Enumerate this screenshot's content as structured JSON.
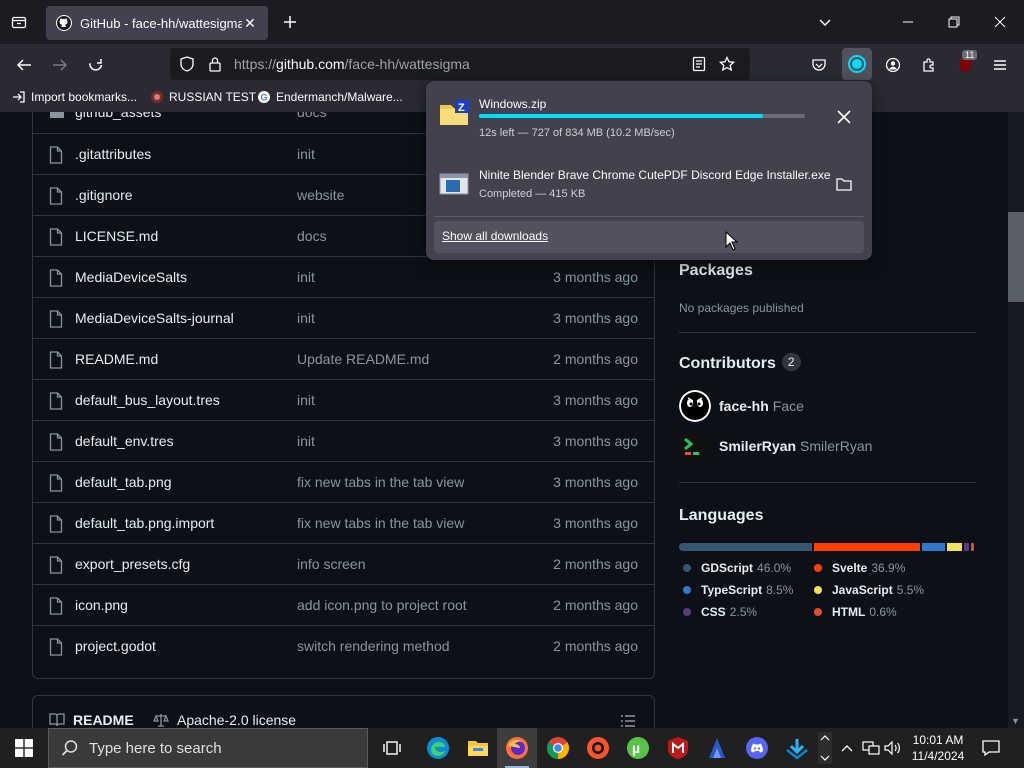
{
  "browser": {
    "tab_title": "GitHub - face-hh/wattesigma",
    "url_prefix": "https://",
    "url_host": "github.com",
    "url_path": "/face-hh/wattesigma",
    "bookmarks": [
      "Import bookmarks...",
      "RUSSIAN TEST",
      "Endermanch/Malware..."
    ],
    "extensions_badge": "11"
  },
  "files": [
    {
      "name": "github_assets",
      "message": "docs",
      "date": "",
      "type": "folder"
    },
    {
      "name": ".gitattributes",
      "message": "init",
      "date": "",
      "type": "file"
    },
    {
      "name": ".gitignore",
      "message": "website",
      "date": "",
      "type": "file"
    },
    {
      "name": "LICENSE.md",
      "message": "docs",
      "date": "",
      "type": "file"
    },
    {
      "name": "MediaDeviceSalts",
      "message": "init",
      "date": "3 months ago",
      "type": "file"
    },
    {
      "name": "MediaDeviceSalts-journal",
      "message": "init",
      "date": "3 months ago",
      "type": "file"
    },
    {
      "name": "README.md",
      "message": "Update README.md",
      "date": "2 months ago",
      "type": "file"
    },
    {
      "name": "default_bus_layout.tres",
      "message": "init",
      "date": "3 months ago",
      "type": "file"
    },
    {
      "name": "default_env.tres",
      "message": "init",
      "date": "3 months ago",
      "type": "file"
    },
    {
      "name": "default_tab.png",
      "message": "fix new tabs in the tab view",
      "date": "3 months ago",
      "type": "file"
    },
    {
      "name": "default_tab.png.import",
      "message": "fix new tabs in the tab view",
      "date": "3 months ago",
      "type": "file"
    },
    {
      "name": "export_presets.cfg",
      "message": "info screen",
      "date": "2 months ago",
      "type": "file"
    },
    {
      "name": "icon.png",
      "message": "add icon.png to project root",
      "date": "2 months ago",
      "type": "file"
    },
    {
      "name": "project.godot",
      "message": "switch rendering method",
      "date": "2 months ago",
      "type": "file"
    }
  ],
  "readme_bar": {
    "readme": "README",
    "license": "Apache-2.0 license"
  },
  "sidebar": {
    "packages_title": "Packages",
    "packages_sub": "No packages published",
    "contributors_title": "Contributors",
    "contributors_count": "2",
    "contributors": [
      {
        "login": "face-hh",
        "name": "Face"
      },
      {
        "login": "SmilerRyan",
        "name": "SmilerRyan"
      }
    ],
    "languages_title": "Languages",
    "languages": [
      {
        "name": "GDScript",
        "percent": "46.0%",
        "value": 46.0,
        "color": "#355570"
      },
      {
        "name": "Svelte",
        "percent": "36.9%",
        "value": 36.9,
        "color": "#ff3e00"
      },
      {
        "name": "TypeScript",
        "percent": "8.5%",
        "value": 8.5,
        "color": "#3178c6"
      },
      {
        "name": "JavaScript",
        "percent": "5.5%",
        "value": 5.5,
        "color": "#f1e05a"
      },
      {
        "name": "CSS",
        "percent": "2.5%",
        "value": 2.5,
        "color": "#563d7c"
      },
      {
        "name": "HTML",
        "percent": "0.6%",
        "value": 0.6,
        "color": "#e34c26"
      }
    ]
  },
  "downloads": {
    "items": [
      {
        "name": "Windows.zip",
        "status": "12s left — 727 of 834 MB (10.2 MB/sec)",
        "progress": 0.872
      },
      {
        "name": "Ninite Blender Brave Chrome CutePDF Discord Edge Installer.exe",
        "status": "Completed — 415 KB"
      }
    ],
    "show_all": "Show all downloads"
  },
  "taskbar": {
    "search_placeholder": "Type here to search",
    "time": "10:01 AM",
    "date": "11/4/2024"
  }
}
